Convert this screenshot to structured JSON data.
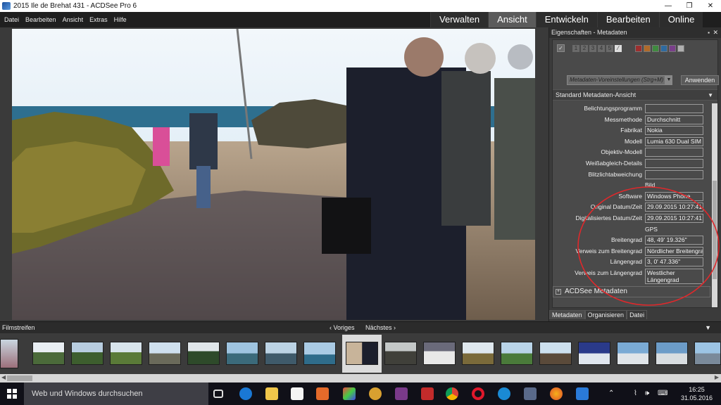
{
  "window": {
    "title": "2015 Ile de Brehat 431 - ACDSee Pro 6",
    "controls": [
      "—",
      "❐",
      "✕"
    ]
  },
  "menu": [
    "Datei",
    "Bearbeiten",
    "Ansicht",
    "Extras",
    "Hilfe"
  ],
  "mode_tabs": [
    "Verwalten",
    "Ansicht",
    "Entwickeln",
    "Bearbeiten",
    "Online"
  ],
  "active_mode": "Ansicht",
  "panel": {
    "title": "Eigenschaften - Metadaten",
    "pin": "▪",
    "close": "✕",
    "rating_numbers": [
      "1",
      "2",
      "3",
      "4",
      "5"
    ],
    "label_colors": [
      "#9c2e2e",
      "#b06a2a",
      "#3f8a3f",
      "#2e6aa0",
      "#7a3f8a",
      "#b0b0b0"
    ],
    "preset_placeholder": "Metadaten-Voreinstellungen (Strg+M)",
    "apply_label": "Anwenden",
    "view_label": "Standard Metadaten-Ansicht",
    "fields": [
      {
        "label": "Belichtungsprogramm",
        "value": ""
      },
      {
        "label": "Messmethode",
        "value": "Durchschnitt"
      },
      {
        "label": "Fabrikat",
        "value": "Nokia"
      },
      {
        "label": "Modell",
        "value": "Lumia 630 Dual SIM"
      },
      {
        "label": "Objektiv-Modell",
        "value": ""
      },
      {
        "label": "Weißabgleich-Details",
        "value": ""
      },
      {
        "label": "Blitzlichtabweichung",
        "value": ""
      }
    ],
    "section_bild": "Bild",
    "fields_bild": [
      {
        "label": "Software",
        "value": "Windows Phone"
      },
      {
        "label": "Original Datum/Zeit",
        "value": "29.09.2015 10:27:41"
      },
      {
        "label": "Digitalisiertes Datum/Zeit",
        "value": "29.09.2015 10:27:41"
      }
    ],
    "section_gps": "GPS",
    "fields_gps": [
      {
        "label": "Breitengrad",
        "value": "48, 49' 19.326\""
      },
      {
        "label": "Verweis zum Breitengrad",
        "value": "Nördlicher Breitengrad"
      },
      {
        "label": "Längengrad",
        "value": "3, 0' 47.336\""
      },
      {
        "label": "Verweis zum Längengrad",
        "value": "Westlicher Längengrad"
      }
    ],
    "acdsee_section": "ACDSee Metadaten",
    "tabs": [
      "Metadaten",
      "Organisieren",
      "Datei"
    ]
  },
  "filmstrip": {
    "title": "Filmstreifen",
    "prev_label": "‹ Voriges",
    "next_label": "Nächstes ›",
    "collapse": "▼"
  },
  "taskbar": {
    "search_placeholder": "Web und Windows durchsuchen",
    "time": "16:25",
    "date": "31.05.2016"
  }
}
